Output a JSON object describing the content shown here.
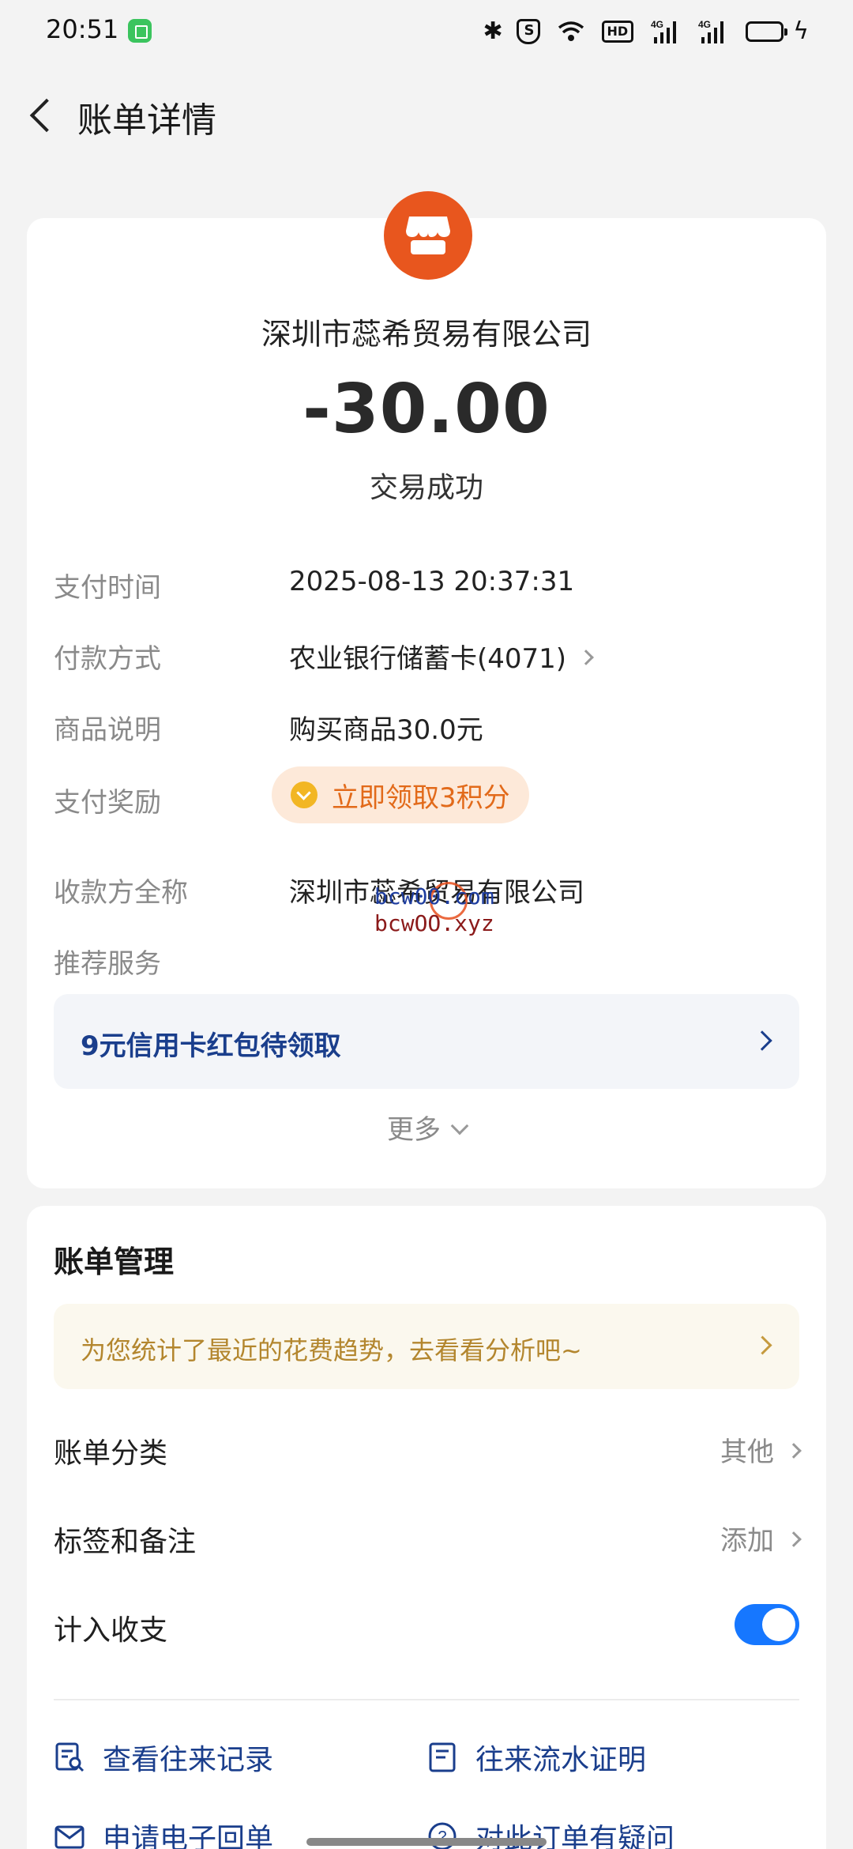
{
  "status_bar": {
    "time": "20:51",
    "network_badge": "HD",
    "sim1_label": "4G",
    "sim2_label": "4G"
  },
  "header": {
    "title": "账单详情"
  },
  "transaction": {
    "merchant_name": "深圳市蕊希贸易有限公司",
    "amount": "-30.00",
    "status": "交易成功",
    "logo_color": "#e8561e"
  },
  "details": {
    "pay_time_label": "支付时间",
    "pay_time_value": "2025-08-13 20:37:31",
    "pay_method_label": "付款方式",
    "pay_method_value": "农业银行储蓄卡(4071)",
    "product_label": "商品说明",
    "product_value": "购买商品30.0元",
    "reward_label": "支付奖励",
    "reward_value": "立即领取3积分",
    "payee_label": "收款方全称",
    "payee_value": "深圳市蕊希贸易有限公司",
    "recommend_label": "推荐服务"
  },
  "watermark": {
    "line1": "bcw00.com",
    "line2": "bcwOO.xyz"
  },
  "promo": {
    "text": "9元信用卡红包待领取"
  },
  "more": {
    "label": "更多"
  },
  "management": {
    "title": "账单管理",
    "analysis_banner": "为您统计了最近的花费趋势，去看看分析吧~",
    "category_label": "账单分类",
    "category_value": "其他",
    "tags_label": "标签和备注",
    "tags_value": "添加",
    "include_label": "计入收支",
    "include_enabled": true
  },
  "actions": {
    "records": "查看往来记录",
    "proof": "往来流水证明",
    "receipt": "申请电子回单",
    "question": "对此订单有疑问"
  },
  "colors": {
    "accent_blue": "#1677ff",
    "link_blue": "#1a3e8c",
    "reward_orange": "#e26a1a",
    "banner_gold": "#b3862e"
  }
}
